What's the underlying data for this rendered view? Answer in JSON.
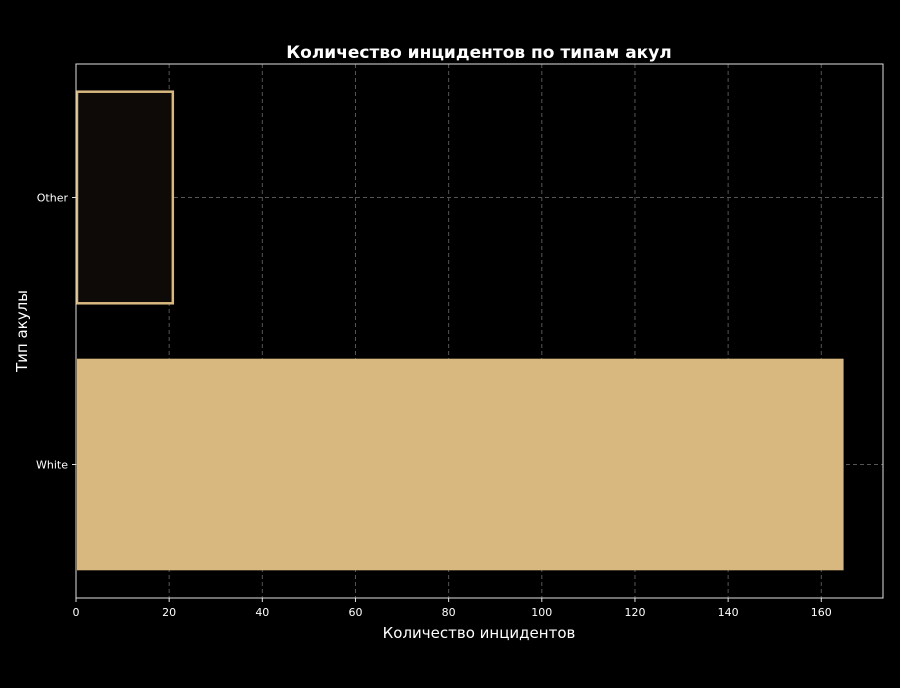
{
  "chart_data": {
    "type": "bar",
    "orientation": "horizontal",
    "title": "Количество инцидентов по типам акул",
    "xlabel": "Количество инцидентов",
    "ylabel": "Тип акулы",
    "categories": [
      "Other",
      "White"
    ],
    "values": [
      21,
      165
    ],
    "xlim": [
      0,
      173.25
    ],
    "xticks": [
      0,
      20,
      40,
      60,
      80,
      100,
      120,
      140,
      160
    ],
    "grid": true,
    "bar_styles": [
      {
        "fill": "#0d0a07",
        "stroke": "#d8b87e"
      },
      {
        "fill": "#d8b87e",
        "stroke": "none"
      }
    ],
    "colors": {
      "background": "#000000",
      "axis": "#e0e0e0",
      "grid": "#555555"
    }
  }
}
